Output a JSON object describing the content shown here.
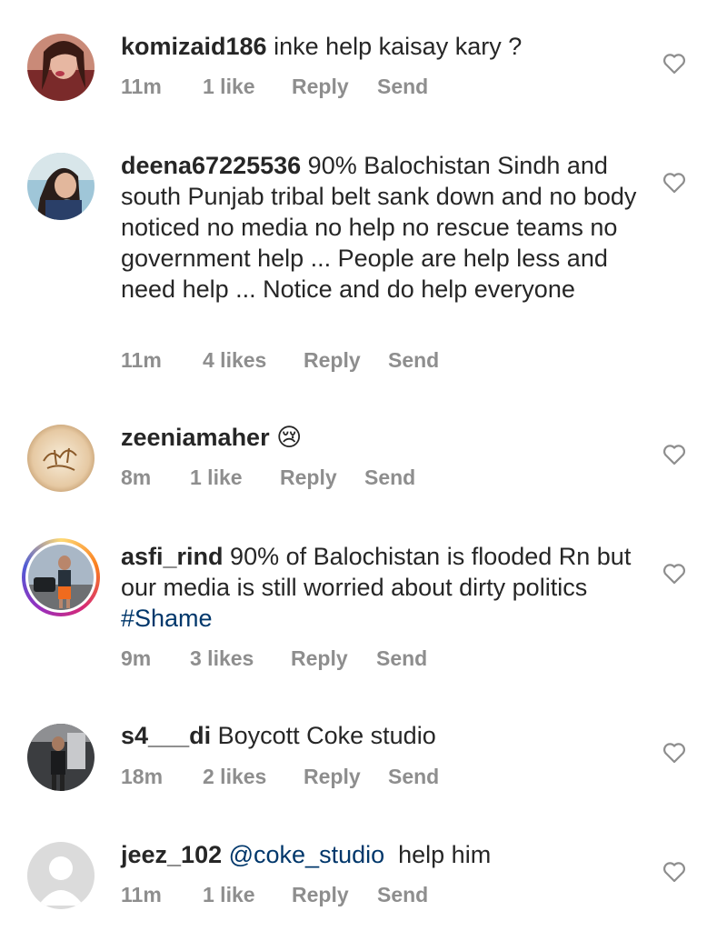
{
  "comments": [
    {
      "username": "komizaid186",
      "text": " inke help kaisay kary ?",
      "time": "11m",
      "likes": "1 like",
      "reply": "Reply",
      "send": "Send",
      "avatar": "user-avatar-photo"
    },
    {
      "username": "deena67225536",
      "text": " 90% Balochistan Sindh and south Punjab tribal belt sank down and no body noticed no media no help no rescue teams no government help ... People are help less and need help ... Notice and do help everyone",
      "time": "11m",
      "likes": "4 likes",
      "reply": "Reply",
      "send": "Send",
      "avatar": "user-avatar-photo"
    },
    {
      "username": "zeeniamaher",
      "text": " 😢",
      "time": "8m",
      "likes": "1 like",
      "reply": "Reply",
      "send": "Send",
      "avatar": "calligraphy-avatar"
    },
    {
      "username": "asfi_rind",
      "text": " 90% of Balochistan is flooded Rn but our media is still worried about dirty politics ",
      "hashtag": "#Shame",
      "time": "9m",
      "likes": "3 likes",
      "reply": "Reply",
      "send": "Send",
      "avatar": "story-ring-avatar"
    },
    {
      "username": "s4___di",
      "text": " Boycott Coke studio",
      "time": "18m",
      "likes": "2 likes",
      "reply": "Reply",
      "send": "Send",
      "avatar": "user-avatar-photo"
    },
    {
      "username": "jeez_102",
      "mention": " @coke_studio",
      "text": "  help him",
      "time": "11m",
      "likes": "1 like",
      "reply": "Reply",
      "send": "Send",
      "avatar": "default-avatar"
    }
  ],
  "colors": {
    "text": "#262626",
    "meta": "#8e8e8e",
    "link": "#00376b"
  },
  "icons": {
    "like": "heart-outline-icon"
  }
}
